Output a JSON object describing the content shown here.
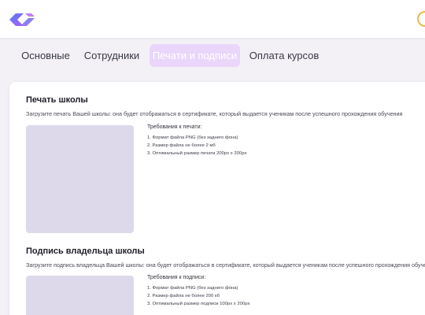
{
  "tabs": [
    {
      "label": "Основные",
      "active": false
    },
    {
      "label": "Сотрудники",
      "active": false
    },
    {
      "label": "Печати и подписи",
      "active": true
    },
    {
      "label": "Оплата курсов",
      "active": false
    }
  ],
  "seal": {
    "title": "Печать школы",
    "description": "Загрузите печать Вашей школы: она будет отображаться в сертификате, который выдается ученикам после успешного прохождения обучения",
    "requirements_title": "Требования к печати:",
    "requirements": [
      "1. Формат файла PNG (без заднего фона)",
      "2. Размер файла не более 2 мб",
      "3. Оптимальный размер печати 200px х 200px"
    ]
  },
  "signature": {
    "title": "Подпись владельца школы",
    "description": "Загрузите подпись владельца Вашей школы: она будет отображаться в сертификате, который выдается ученикам после успешного прохождения обучения",
    "requirements_title": "Требования к подписи:",
    "requirements": [
      "1. Формат файла PNG (без заднего фона)",
      "2. Размер файла не более 200 кб",
      "3. Оптимальный размер подписи 100px х 200px"
    ]
  },
  "colors": {
    "accent": "#ead6fb",
    "upload_placeholder": "#ded9ea",
    "logo_gradient_start": "#4f7df2",
    "logo_gradient_end": "#b15ef5"
  },
  "icons": {
    "logo": "brand-logo-icon",
    "notification": "notification-icon"
  }
}
